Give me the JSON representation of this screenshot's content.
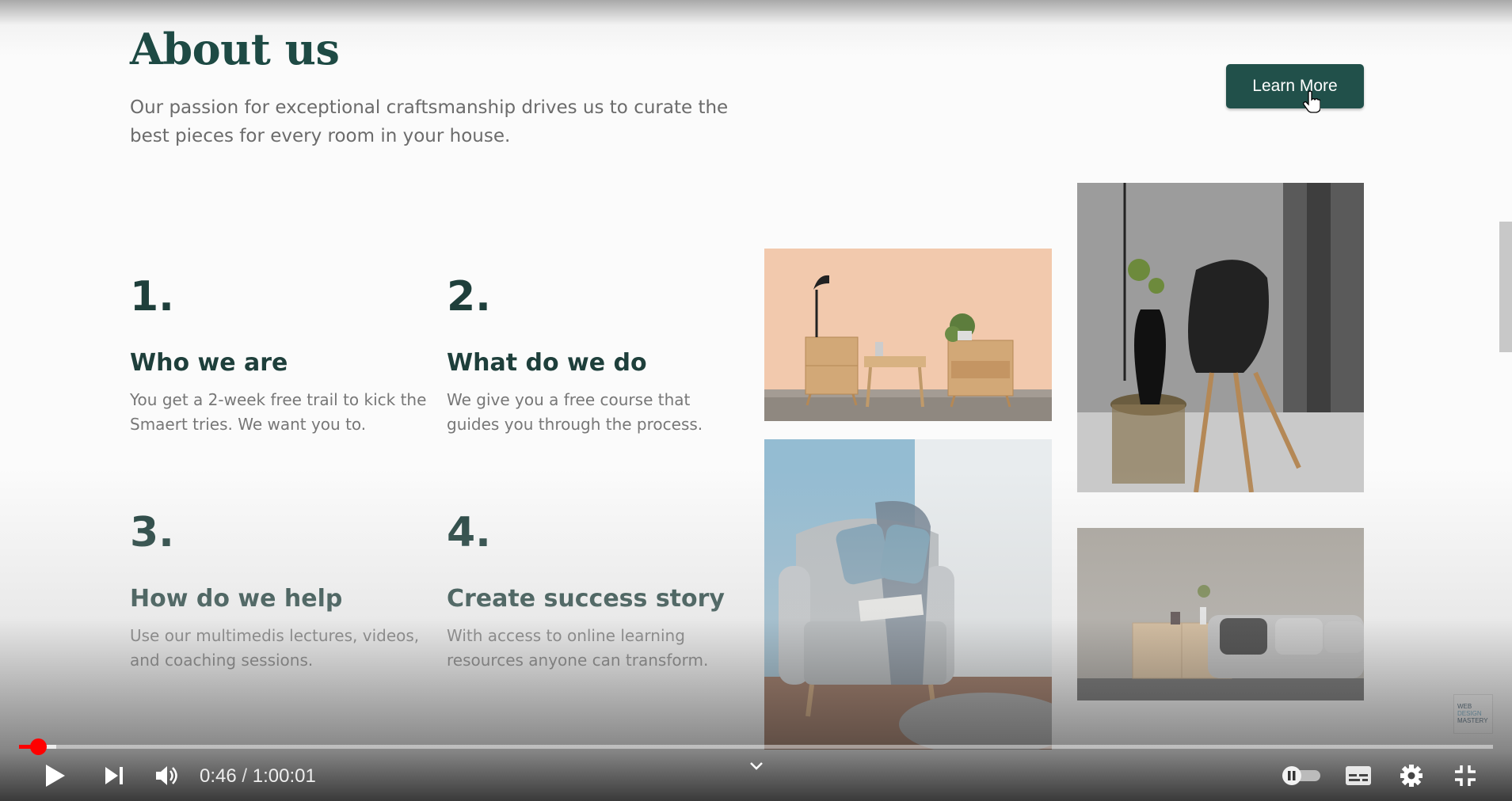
{
  "about": {
    "title": "About us",
    "lede": "Our passion for exceptional craftsmanship drives us to curate the best pieces for every room in your house.",
    "cta_label": "Learn More"
  },
  "features": [
    {
      "num": "1.",
      "title": "Who we are",
      "desc": "You get a 2-week free trail to kick the Smaert tries. We want you to."
    },
    {
      "num": "2.",
      "title": "What do we do",
      "desc": "We give you a free course that guides you through the process."
    },
    {
      "num": "3.",
      "title": "How do we help",
      "desc": "Use our multimedis lectures, videos, and coaching sessions."
    },
    {
      "num": "4.",
      "title": "Create success story",
      "desc": "With access to online learning resources anyone can transform."
    }
  ],
  "badge": {
    "line1": "WEB",
    "line2": "DESIGN",
    "line3": "MASTERY"
  },
  "player": {
    "current_time": "0:46",
    "separator": "/",
    "duration": "1:00:01",
    "played_fraction": 0.013,
    "buffered_fraction": 0.025
  },
  "colors": {
    "accent": "#21504a",
    "heading": "#1e3f3b",
    "progress": "#ff0000"
  },
  "icons": [
    "play-icon",
    "next-icon",
    "volume-icon",
    "chevron-down-icon",
    "autoplay-toggle-icon",
    "subtitles-icon",
    "settings-icon",
    "exit-fullscreen-icon",
    "hand-cursor-icon"
  ]
}
